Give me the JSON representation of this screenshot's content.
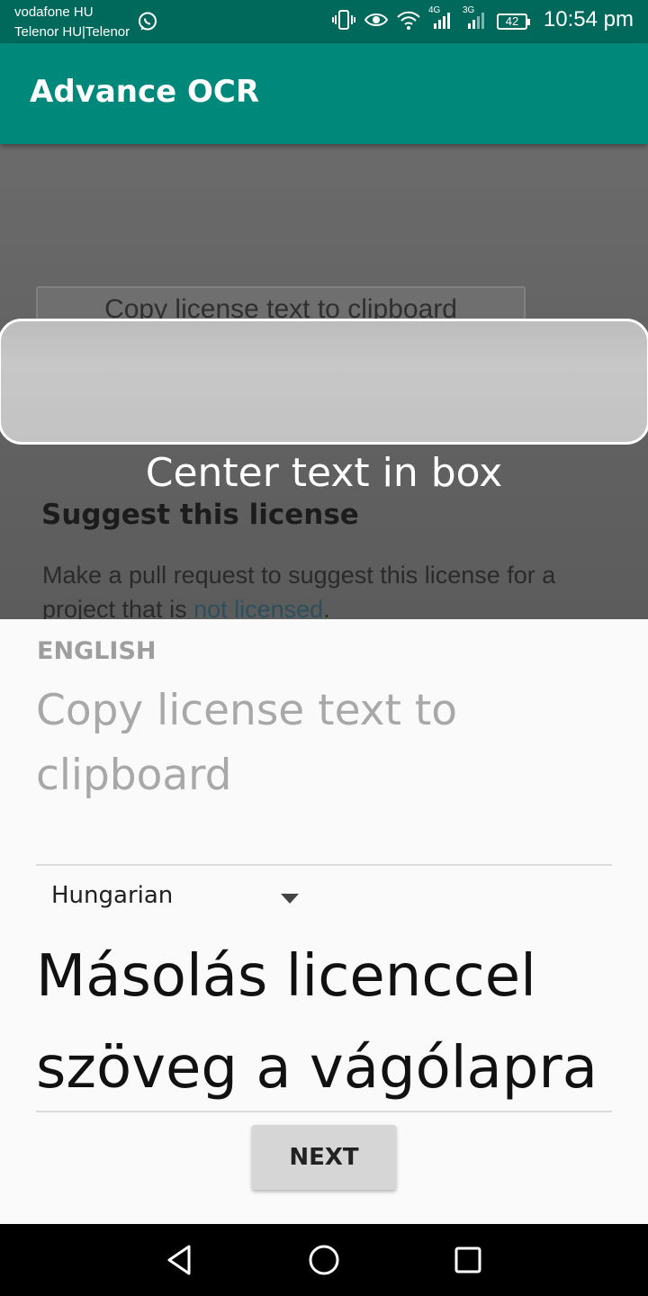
{
  "status_bar": {
    "carrier_1": "vodafone HU",
    "carrier_2": "Telenor HU|Telenor",
    "network_1": "4G",
    "network_2": "3G",
    "battery_level": "42",
    "time": "10:54 pm",
    "icons": [
      "whatsapp-icon",
      "vibrate-icon",
      "eye-icon",
      "wifi-icon",
      "signal-icon",
      "signal-icon",
      "battery-icon"
    ]
  },
  "app_bar": {
    "title": "Advance OCR",
    "color": "#00897b"
  },
  "camera": {
    "captured_button_text": "Copy license text to clipboard",
    "hint": "Center text in box",
    "heading": "Suggest this license",
    "paragraph_prefix": "Make a pull request to suggest this license for a project that is ",
    "paragraph_link": "not licensed",
    "paragraph_suffix": "."
  },
  "result": {
    "source_language": "ENGLISH",
    "source_text": "Copy license text to clipboard",
    "target_language": "Hungarian",
    "translated_text": "Másolás licenccel szöveg a vágólapra",
    "next_label": "NEXT"
  },
  "nav_bar": {
    "icons": [
      "back-icon",
      "home-icon",
      "recents-icon"
    ]
  }
}
